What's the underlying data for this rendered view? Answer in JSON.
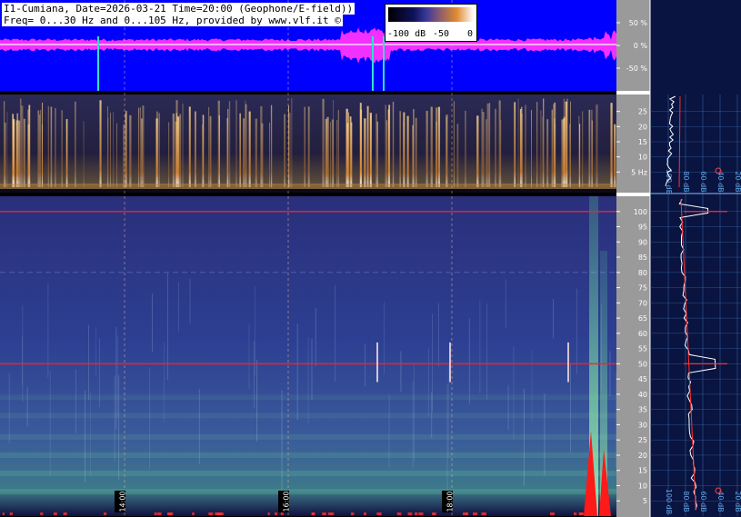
{
  "header": {
    "title": "I1-Cumiana, Date=2026-03-21 Time=20:00 (Geophone/E-field))",
    "freq": "Freq= 0...30 Hz and 0...105 Hz, provided by www.vlf.it ©"
  },
  "legend": {
    "labels": [
      "-100 dB",
      "-50",
      "0"
    ]
  },
  "colors": {
    "waveform_bg": "#0000ff",
    "waveform": "#ff33ff",
    "spectrogram_low_bg": "#1b1f46",
    "spectrogram_high_bg": "#2a3a8a",
    "hum_line": "#ff2020",
    "panel_bg": "#0a1440",
    "grid": "#3a6fb0",
    "scale_bg": "#9a9a9a"
  },
  "chart_data": [
    {
      "type": "line",
      "panel": "waveform",
      "ytick_labels": [
        "50 %",
        "0 %",
        "-50 %"
      ],
      "yticks": [
        50,
        0,
        -50
      ],
      "ylim": [
        -100,
        100
      ]
    },
    {
      "type": "heatmap",
      "panel": "spectrogram-0-30Hz",
      "ytick_labels": [
        "25",
        "20",
        "15",
        "10",
        "5 Hz"
      ],
      "yticks": [
        25,
        20,
        15,
        10,
        5
      ],
      "ylim": [
        0,
        30
      ],
      "time_ticks": [
        "14:00",
        "16:00",
        "18:00"
      ]
    },
    {
      "type": "heatmap",
      "panel": "spectrogram-0-105Hz",
      "ytick_labels": [
        "100",
        "95",
        "90",
        "85",
        "80",
        "75",
        "70",
        "65",
        "60",
        "55",
        "50",
        "45",
        "40",
        "35",
        "30",
        "25",
        "20",
        "15",
        "10",
        "5"
      ],
      "yticks": [
        100,
        95,
        90,
        85,
        80,
        75,
        70,
        65,
        60,
        55,
        50,
        45,
        40,
        35,
        30,
        25,
        20,
        15,
        10,
        5
      ],
      "ylim": [
        0,
        105
      ],
      "hum_lines_hz": [
        50,
        100
      ],
      "time_ticks": [
        "14:00",
        "16:00",
        "18:00"
      ]
    },
    {
      "type": "line",
      "panel": "spectrum-profile",
      "xtick_labels": [
        "100 dB",
        "80 dB",
        "60 dB",
        "40 dB",
        "20 dB"
      ]
    }
  ]
}
